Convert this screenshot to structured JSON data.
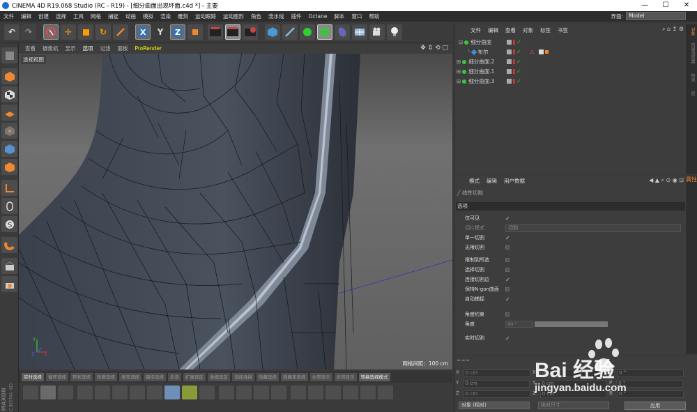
{
  "window": {
    "title": "CINEMA 4D R19.068 Studio (RC - R19) - [细分曲面出现坏面.c4d *] - 主要",
    "min": "—",
    "max": "☐",
    "close": "✕"
  },
  "menu": {
    "items": [
      "文件",
      "编辑",
      "创建",
      "选择",
      "工具",
      "网格",
      "捕捉",
      "动画",
      "模拟",
      "渲染",
      "雕刻",
      "运动跟踪",
      "运动图形",
      "角色",
      "流水线",
      "插件",
      "Octane",
      "脚本",
      "窗口",
      "帮助"
    ],
    "layout_label": "界面:",
    "layout_value": "Model"
  },
  "viewport": {
    "menu": [
      "查看",
      "摄像机",
      "显示",
      "选项",
      "过滤",
      "面板",
      "ProRender"
    ],
    "label": "透视视图",
    "grid": "网格间距：100 cm"
  },
  "selection_bar": [
    "实时选择",
    "循环选择",
    "环状选择",
    "轮廓选择",
    "填充选择",
    "路径选择",
    "反选",
    "扩展选区",
    "收缩选区",
    "选择连接",
    "隐藏选择",
    "隐藏未选择",
    "全部显示",
    "反转显示",
    "转换选择模式"
  ],
  "objects": {
    "menu": [
      "文件",
      "编辑",
      "查看",
      "对象",
      "标签",
      "书签"
    ],
    "rows": [
      "细分曲面",
      "布尔",
      "细分曲面.2",
      "细分曲面.1",
      "细分曲面.3"
    ]
  },
  "side_tabs": [
    "对象",
    "内容浏览器",
    "构造",
    "层"
  ],
  "side_tabs2": [
    "属性"
  ],
  "attributes": {
    "menu": [
      "模式",
      "编辑",
      "用户数据"
    ],
    "title": "线性切割",
    "section": "选项",
    "rows": [
      {
        "label": "仅可见",
        "value": "✓"
      },
      {
        "label": "切片模式",
        "value": "切割"
      },
      {
        "label": "单一切割",
        "value": "✓"
      },
      {
        "label": "无限切割",
        "value": ""
      },
      {
        "label": "限制到所选",
        "value": ""
      },
      {
        "label": "选择切割",
        "value": ""
      },
      {
        "label": "连接切割边",
        "value": "✓"
      },
      {
        "label": "保持N-gon曲面",
        "value": ""
      },
      {
        "label": "自动捕捉",
        "value": "✓"
      },
      {
        "label": "角度约束",
        "value": ""
      },
      {
        "label": "角度",
        "value": "90 °"
      },
      {
        "label": "实时切割",
        "value": "✓"
      }
    ]
  },
  "coords": {
    "rows": [
      [
        "X",
        "0 cm",
        "X",
        "0 cm",
        "H",
        "0 °"
      ],
      [
        "Y",
        "0 cm",
        "Y",
        "0 cm",
        "P",
        "0 °"
      ],
      [
        "Z",
        "0 cm",
        "Z",
        "0 cm",
        "B",
        "0 °"
      ]
    ],
    "mode": "对象 (相对)",
    "size": "绝对尺寸",
    "apply": "应用"
  },
  "branding": {
    "maxon": "MAXON",
    "c4d": "CINEMA 4D",
    "watermark": "Bai 经验",
    "url": "jingyan.baidu.com"
  }
}
